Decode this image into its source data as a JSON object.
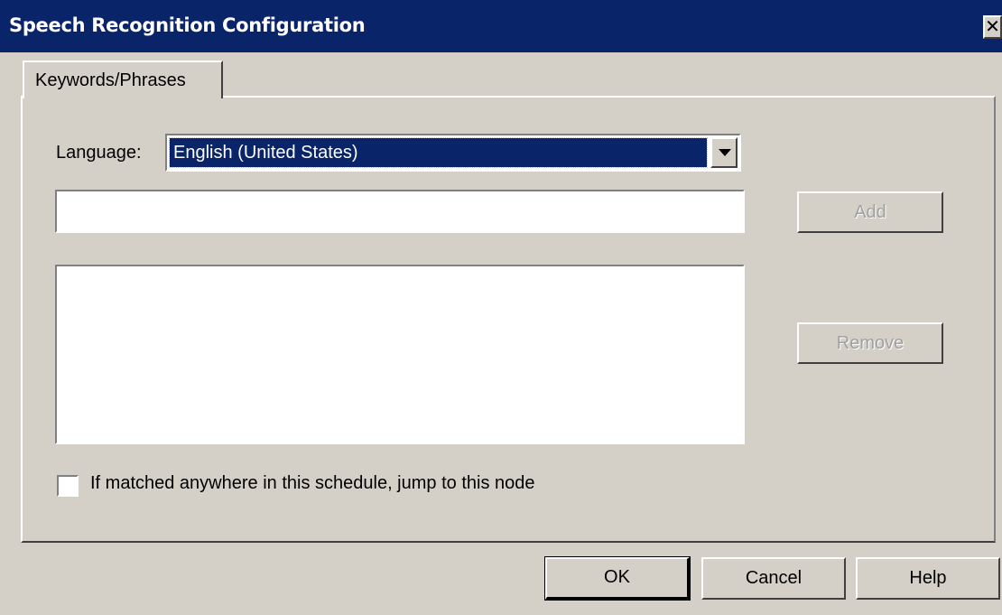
{
  "window": {
    "title": "Speech Recognition Configuration",
    "close_glyph": "✕"
  },
  "tabs": [
    {
      "label": "Keywords/Phrases",
      "active": true
    }
  ],
  "language": {
    "label": "Language:",
    "selected": "English (United States)"
  },
  "phrase_input": {
    "value": "",
    "placeholder": ""
  },
  "phrase_list": {
    "items": []
  },
  "buttons": {
    "add": "Add",
    "remove": "Remove",
    "ok": "OK",
    "cancel": "Cancel",
    "help": "Help"
  },
  "checkbox": {
    "label": "If matched anywhere in this schedule, jump to this node",
    "checked": false
  },
  "colors": {
    "face": "#d4d0c8",
    "titlebar": "#0a246a",
    "selection": "#0a246a",
    "disabled_text": "#a0a0a0"
  },
  "icons": {
    "close": "close-icon",
    "dropdown": "chevron-down-icon"
  }
}
